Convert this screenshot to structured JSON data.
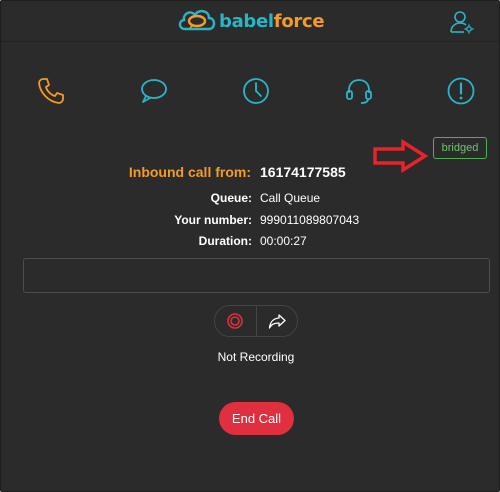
{
  "brand": {
    "babel": "babel",
    "force": "force",
    "colors": {
      "teal": "#28b6c7",
      "orange": "#f39a2b"
    }
  },
  "header": {
    "user_icon": "user-settings-icon"
  },
  "nav": {
    "items": [
      {
        "icon": "phone-icon",
        "active": true
      },
      {
        "icon": "chat-bubble-icon",
        "active": false
      },
      {
        "icon": "clock-icon",
        "active": false
      },
      {
        "icon": "headset-icon",
        "active": false
      },
      {
        "icon": "alert-icon",
        "active": false
      }
    ]
  },
  "call": {
    "status": "bridged",
    "title": "Inbound call from:",
    "number": "16174177585",
    "queue_label": "Queue:",
    "queue_value": "Call Queue",
    "your_number_label": "Your number:",
    "your_number_value": "999011089807043",
    "duration_label": "Duration:",
    "duration_value": "00:00:27"
  },
  "notes": {
    "value": "",
    "placeholder": ""
  },
  "controls": {
    "record_icon": "record-icon",
    "transfer_icon": "forward-share-icon",
    "recording_status": "Not Recording",
    "end_call_label": "End Call"
  },
  "colors": {
    "background": "#2b2b2b",
    "accent_orange": "#f39a2b",
    "accent_teal": "#28b6c7",
    "status_green": "#4caf50",
    "danger_red": "#e0303f",
    "annotation_red": "#e8232a"
  }
}
